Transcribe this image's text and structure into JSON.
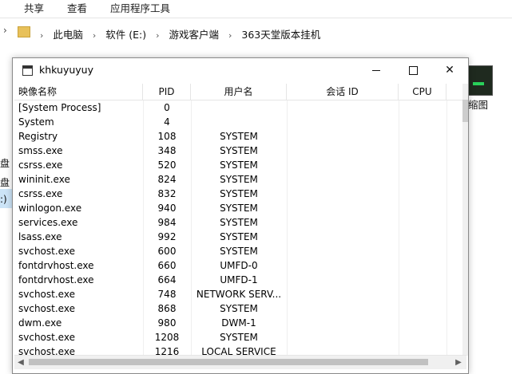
{
  "explorer": {
    "ribbon_tabs": [
      "共享",
      "查看",
      "应用程序工具"
    ],
    "breadcrumb": [
      "此电脑",
      "软件 (E:)",
      "游戏客户端",
      "363天堂版本挂机"
    ],
    "left_fragments": [
      "盘 (",
      "盘 (",
      ":)"
    ],
    "thumbnail_label": "缩图"
  },
  "window": {
    "title": "khkuyuyuy",
    "controls": {
      "minimize": "",
      "maximize": "",
      "close": "✕"
    }
  },
  "list": {
    "columns": [
      "映像名称",
      "PID",
      "用户名",
      "会话 ID",
      "CPU"
    ],
    "rows": [
      {
        "name": "[System Process]",
        "pid": "0",
        "user": ""
      },
      {
        "name": "System",
        "pid": "4",
        "user": ""
      },
      {
        "name": "Registry",
        "pid": "108",
        "user": "SYSTEM"
      },
      {
        "name": "smss.exe",
        "pid": "348",
        "user": "SYSTEM"
      },
      {
        "name": "csrss.exe",
        "pid": "520",
        "user": "SYSTEM"
      },
      {
        "name": "wininit.exe",
        "pid": "824",
        "user": "SYSTEM"
      },
      {
        "name": "csrss.exe",
        "pid": "832",
        "user": "SYSTEM"
      },
      {
        "name": "winlogon.exe",
        "pid": "940",
        "user": "SYSTEM"
      },
      {
        "name": "services.exe",
        "pid": "984",
        "user": "SYSTEM"
      },
      {
        "name": "lsass.exe",
        "pid": "992",
        "user": "SYSTEM"
      },
      {
        "name": "svchost.exe",
        "pid": "600",
        "user": "SYSTEM"
      },
      {
        "name": "fontdrvhost.exe",
        "pid": "660",
        "user": "UMFD-0"
      },
      {
        "name": "fontdrvhost.exe",
        "pid": "664",
        "user": "UMFD-1"
      },
      {
        "name": "svchost.exe",
        "pid": "748",
        "user": "NETWORK SERV..."
      },
      {
        "name": "svchost.exe",
        "pid": "868",
        "user": "SYSTEM"
      },
      {
        "name": "dwm.exe",
        "pid": "980",
        "user": "DWM-1"
      },
      {
        "name": "svchost.exe",
        "pid": "1208",
        "user": "SYSTEM"
      },
      {
        "name": "svchost.exe",
        "pid": "1216",
        "user": "LOCAL SERVICE"
      }
    ]
  },
  "scrollbar": {
    "left_arrow": "◀",
    "right_arrow": "▶"
  }
}
